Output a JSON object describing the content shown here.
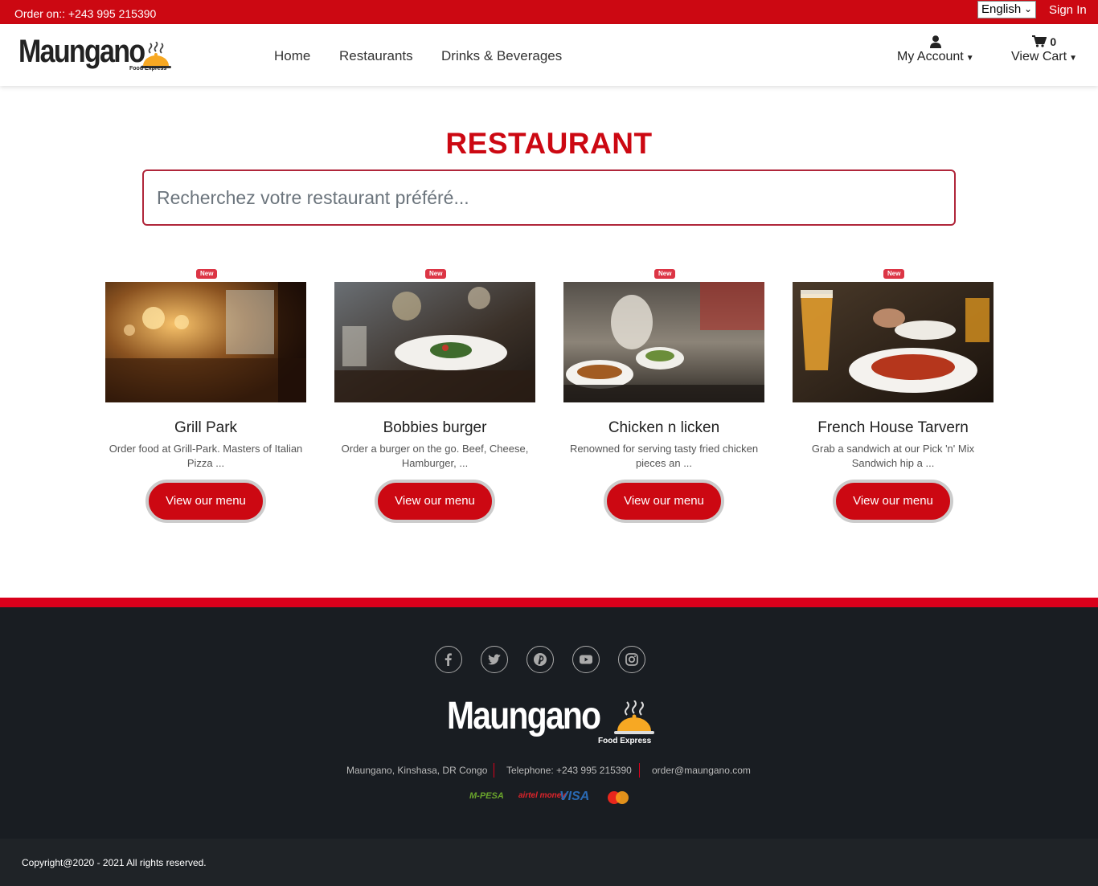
{
  "topbar": {
    "order_text": "Order on:: +243 995 215390",
    "language": "English",
    "signin": "Sign In"
  },
  "brand": {
    "name": "Maungano",
    "tagline": "Food Express"
  },
  "nav": {
    "items": [
      "Home",
      "Restaurants",
      "Drinks & Beverages"
    ]
  },
  "account": {
    "my_account": "My Account",
    "cart_count": "0",
    "view_cart": "View Cart"
  },
  "main": {
    "title": "RESTAURANT",
    "search_placeholder": "Recherchez votre restaurant préféré...",
    "restaurants": [
      {
        "badge": "New",
        "name": "Grill Park",
        "description": "Order food at Grill-Park. Masters of Italian Pizza ...",
        "button": "View our menu"
      },
      {
        "badge": "New",
        "name": "Bobbies burger",
        "description": "Order a burger on the go. Beef, Cheese, Hamburger, ...",
        "button": "View our menu"
      },
      {
        "badge": "New",
        "name": "Chicken n licken",
        "description": "Renowned for serving tasty fried chicken pieces an ...",
        "button": "View our menu"
      },
      {
        "badge": "New",
        "name": "French House Tarvern",
        "description": "Grab a sandwich at our Pick 'n' Mix Sandwich hip a ...",
        "button": "View our menu"
      }
    ]
  },
  "footer": {
    "social_icons": [
      "facebook-icon",
      "twitter-icon",
      "pinterest-icon",
      "youtube-icon",
      "instagram-icon"
    ],
    "address": "Maungano, Kinshasa, DR Congo",
    "telephone": "Telephone: +243 995 215390",
    "email": "order@maungano.com",
    "payments": {
      "mpesa": "M-PESA",
      "airtel": "airtel money",
      "visa": "VISA",
      "mastercard": "MasterCard"
    },
    "copyright": "Copyright@2020 - 2021 All rights reserved."
  },
  "colors": {
    "brand_red": "#cc0812",
    "footer_dark": "#191d22",
    "badge_red": "#dc3545"
  }
}
